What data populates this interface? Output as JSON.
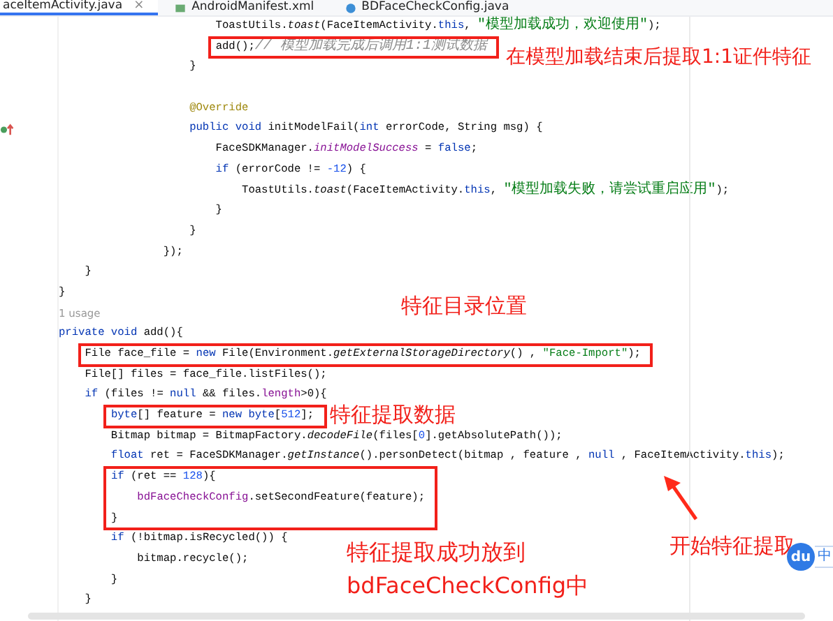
{
  "tabs": [
    {
      "label": "aceItemActivity.java",
      "kind": "java",
      "selected": true,
      "close": "×"
    },
    {
      "label": "AndroidManifest.xml",
      "kind": "manifest",
      "selected": false
    },
    {
      "label": "BDFaceCheckConfig.java",
      "kind": "class",
      "selected": false
    }
  ],
  "code": [
    {
      "tokens": [
        {
          "t": "                        ToastUtils.",
          "kind": "plain"
        },
        {
          "t": "toast",
          "kind": "italic"
        },
        {
          "t": "(FaceItemActivity.",
          "kind": "plain"
        },
        {
          "t": "this",
          "kind": "kw"
        },
        {
          "t": ", ",
          "kind": "plain"
        },
        {
          "t": "\"模型加载成功，欢迎使用\"",
          "kind": "string"
        },
        {
          "t": ");",
          "kind": "plain"
        }
      ]
    },
    {
      "boxed": true,
      "tokens": [
        {
          "t": "                        add();",
          "kind": "plain"
        },
        {
          "t": "// 模型加载完成后调用1:1测试数据",
          "kind": "comment"
        }
      ]
    },
    {
      "tokens": [
        {
          "t": "                    }",
          "kind": "plain"
        }
      ]
    },
    {
      "gap_before": true,
      "tokens": [
        {
          "t": "                    @Override",
          "kind": "annotation"
        }
      ]
    },
    {
      "marker": true,
      "tokens": [
        {
          "t": "                    public void ",
          "kind": "kw"
        },
        {
          "t": "initModelFail(",
          "kind": "plain"
        },
        {
          "t": "int",
          "kind": "kw"
        },
        {
          "t": " errorCode, String msg) {",
          "kind": "plain"
        }
      ]
    },
    {
      "tokens": [
        {
          "t": "                        FaceSDKManager.",
          "kind": "plain"
        },
        {
          "t": "initModelSuccess",
          "kind": "static"
        },
        {
          "t": " = ",
          "kind": "plain"
        },
        {
          "t": "false",
          "kind": "kw"
        },
        {
          "t": ";",
          "kind": "plain"
        }
      ]
    },
    {
      "tokens": [
        {
          "t": "                        if",
          "kind": "kw"
        },
        {
          "t": " (errorCode != ",
          "kind": "plain"
        },
        {
          "t": "-12",
          "kind": "num"
        },
        {
          "t": ") {",
          "kind": "plain"
        }
      ]
    },
    {
      "tokens": [
        {
          "t": "                            ToastUtils.",
          "kind": "plain"
        },
        {
          "t": "toast",
          "kind": "italic"
        },
        {
          "t": "(FaceItemActivity.",
          "kind": "plain"
        },
        {
          "t": "this",
          "kind": "kw"
        },
        {
          "t": ", ",
          "kind": "plain"
        },
        {
          "t": "\"模型加载失败，请尝试重启应用\"",
          "kind": "string"
        },
        {
          "t": ");",
          "kind": "plain"
        }
      ]
    },
    {
      "tokens": [
        {
          "t": "                        }",
          "kind": "plain"
        }
      ]
    },
    {
      "tokens": [
        {
          "t": "                    }",
          "kind": "plain"
        }
      ]
    },
    {
      "tokens": [
        {
          "t": "                });",
          "kind": "plain"
        }
      ]
    },
    {
      "tokens": [
        {
          "t": "    }",
          "kind": "plain"
        }
      ]
    },
    {
      "tokens": [
        {
          "t": "}",
          "kind": "plain"
        }
      ]
    },
    {
      "tokens": [
        {
          "t": "1 usage",
          "kind": "hint"
        }
      ]
    },
    {
      "tokens": [
        {
          "t": "private void ",
          "kind": "kw"
        },
        {
          "t": "add(){",
          "kind": "plain"
        }
      ]
    },
    {
      "boxed": true,
      "tokens": [
        {
          "t": "    File face_file = ",
          "kind": "plain"
        },
        {
          "t": "new",
          "kind": "kw"
        },
        {
          "t": " File(Environment.",
          "kind": "plain"
        },
        {
          "t": "getExternalStorageDirectory",
          "kind": "italic"
        },
        {
          "t": "() , ",
          "kind": "plain"
        },
        {
          "t": "\"Face-Import\"",
          "kind": "string"
        },
        {
          "t": ");",
          "kind": "plain"
        }
      ]
    },
    {
      "tokens": [
        {
          "t": "    File[] files = face_file.listFiles();",
          "kind": "plain"
        }
      ]
    },
    {
      "tokens": [
        {
          "t": "    if",
          "kind": "kw"
        },
        {
          "t": " (files != ",
          "kind": "plain"
        },
        {
          "t": "null",
          "kind": "kw"
        },
        {
          "t": " && files.",
          "kind": "plain"
        },
        {
          "t": "length",
          "kind": "field"
        },
        {
          "t": ">0){",
          "kind": "plain"
        }
      ]
    },
    {
      "boxed": true,
      "tokens": [
        {
          "t": "        byte",
          "kind": "kw"
        },
        {
          "t": "[] feature = ",
          "kind": "plain"
        },
        {
          "t": "new byte",
          "kind": "kw"
        },
        {
          "t": "[",
          "kind": "plain"
        },
        {
          "t": "512",
          "kind": "num"
        },
        {
          "t": "];",
          "kind": "plain"
        }
      ]
    },
    {
      "tokens": [
        {
          "t": "        Bitmap bitmap = BitmapFactory.",
          "kind": "plain"
        },
        {
          "t": "decodeFile",
          "kind": "italic"
        },
        {
          "t": "(files[",
          "kind": "plain"
        },
        {
          "t": "0",
          "kind": "num"
        },
        {
          "t": "].getAbsolutePath());",
          "kind": "plain"
        }
      ]
    },
    {
      "tokens": [
        {
          "t": "        float",
          "kind": "kw"
        },
        {
          "t": " ret = FaceSDKManager.",
          "kind": "plain"
        },
        {
          "t": "getInstance",
          "kind": "italic"
        },
        {
          "t": "().personDetect(bitmap , feature , ",
          "kind": "plain"
        },
        {
          "t": "null",
          "kind": "kw"
        },
        {
          "t": " , FaceItemActivity.",
          "kind": "plain"
        },
        {
          "t": "this",
          "kind": "kw"
        },
        {
          "t": ");",
          "kind": "plain"
        }
      ]
    },
    {
      "boxed": true,
      "tokens": [
        {
          "t": "        if",
          "kind": "kw"
        },
        {
          "t": " (ret == ",
          "kind": "plain"
        },
        {
          "t": "128",
          "kind": "num"
        },
        {
          "t": "){",
          "kind": "plain"
        }
      ]
    },
    {
      "boxed": true,
      "tokens": [
        {
          "t": "            bdFaceCheckConfig",
          "kind": "field"
        },
        {
          "t": ".setSecondFeature(feature);",
          "kind": "plain"
        }
      ]
    },
    {
      "boxed": true,
      "tokens": [
        {
          "t": "        }",
          "kind": "plain"
        }
      ]
    },
    {
      "tokens": [
        {
          "t": "        if",
          "kind": "kw"
        },
        {
          "t": " (!bitmap.isRecycled()) {",
          "kind": "plain"
        }
      ]
    },
    {
      "tokens": [
        {
          "t": "            bitmap.recycle();",
          "kind": "plain"
        }
      ]
    },
    {
      "tokens": [
        {
          "t": "        }",
          "kind": "plain"
        }
      ]
    },
    {
      "tokens": [
        {
          "t": "    }",
          "kind": "plain"
        }
      ]
    }
  ],
  "notes": [
    {
      "lines": [
        "在模型加载结束后提取1:1证件特征"
      ]
    },
    {
      "lines": [
        "特征目录位置"
      ]
    },
    {
      "lines": [
        "特征提取数据"
      ]
    },
    {
      "lines": [
        "特征提取成功放到",
        "bdFaceCheckConfig中"
      ]
    },
    {
      "lines": [
        "开始特征提取"
      ]
    }
  ],
  "ime": {
    "logo": "du",
    "mode": "中"
  }
}
